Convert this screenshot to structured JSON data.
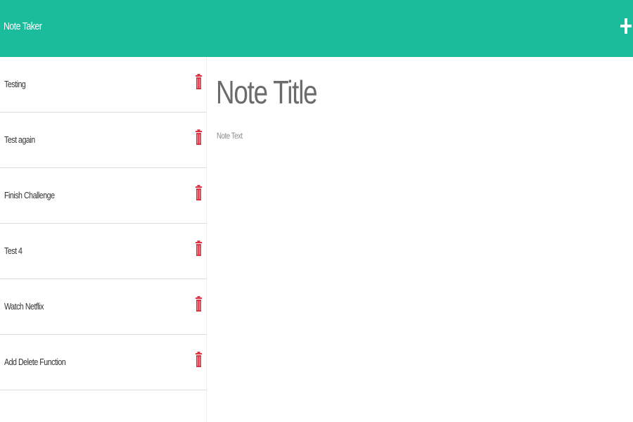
{
  "app": {
    "brand": "Note Taker",
    "accent_color": "#1abc9c",
    "new_note_icon": "plus-icon"
  },
  "sidebar": {
    "delete_icon": "trash-icon",
    "delete_color": "#dc3545",
    "notes": [
      {
        "title": "Testing"
      },
      {
        "title": "Test again"
      },
      {
        "title": "Finish Challenge"
      },
      {
        "title": "Test 4"
      },
      {
        "title": "Watch Netflix"
      },
      {
        "title": "Add Delete Function"
      }
    ]
  },
  "editor": {
    "title_placeholder": "Note Title",
    "text_placeholder": "Note Text"
  }
}
